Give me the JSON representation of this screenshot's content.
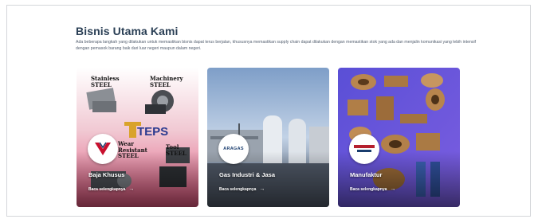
{
  "section": {
    "title": "Bisnis Utama Kami",
    "description": "Ada beberapa langkah yang dilakukan untuk memastikan bisnis dapat terus berjalan, khususnya memastikan supply chain dapat dilakukan dengan memastikan stok yang ada dan menjalin komunikasi yang lebih intensif dengan pemasok barang baik dari luar negeri maupun dalam negeri."
  },
  "cards": [
    {
      "title": "Baja Khusus",
      "link": "Baca selengkapnya",
      "arrow": "→",
      "art_labels": [
        "Stainless",
        "STEEL",
        "Machinery",
        "STEEL",
        "TEPS",
        "Wear",
        "Resistant",
        "STEEL",
        "Tool",
        "STEEL"
      ]
    },
    {
      "title": "Gas Industri & Jasa",
      "link": "Baca selengkapnya",
      "arrow": "→",
      "logo_text": "ARAGAS"
    },
    {
      "title": "Manufaktur",
      "link": "Baca selengkapnya",
      "arrow": "→"
    }
  ],
  "colors": {
    "card1_top": "#c9476b",
    "card1_bottom": "#e85a82",
    "card2_sky": "#9fb8d8",
    "card3_bg": "#6a5bd8"
  }
}
